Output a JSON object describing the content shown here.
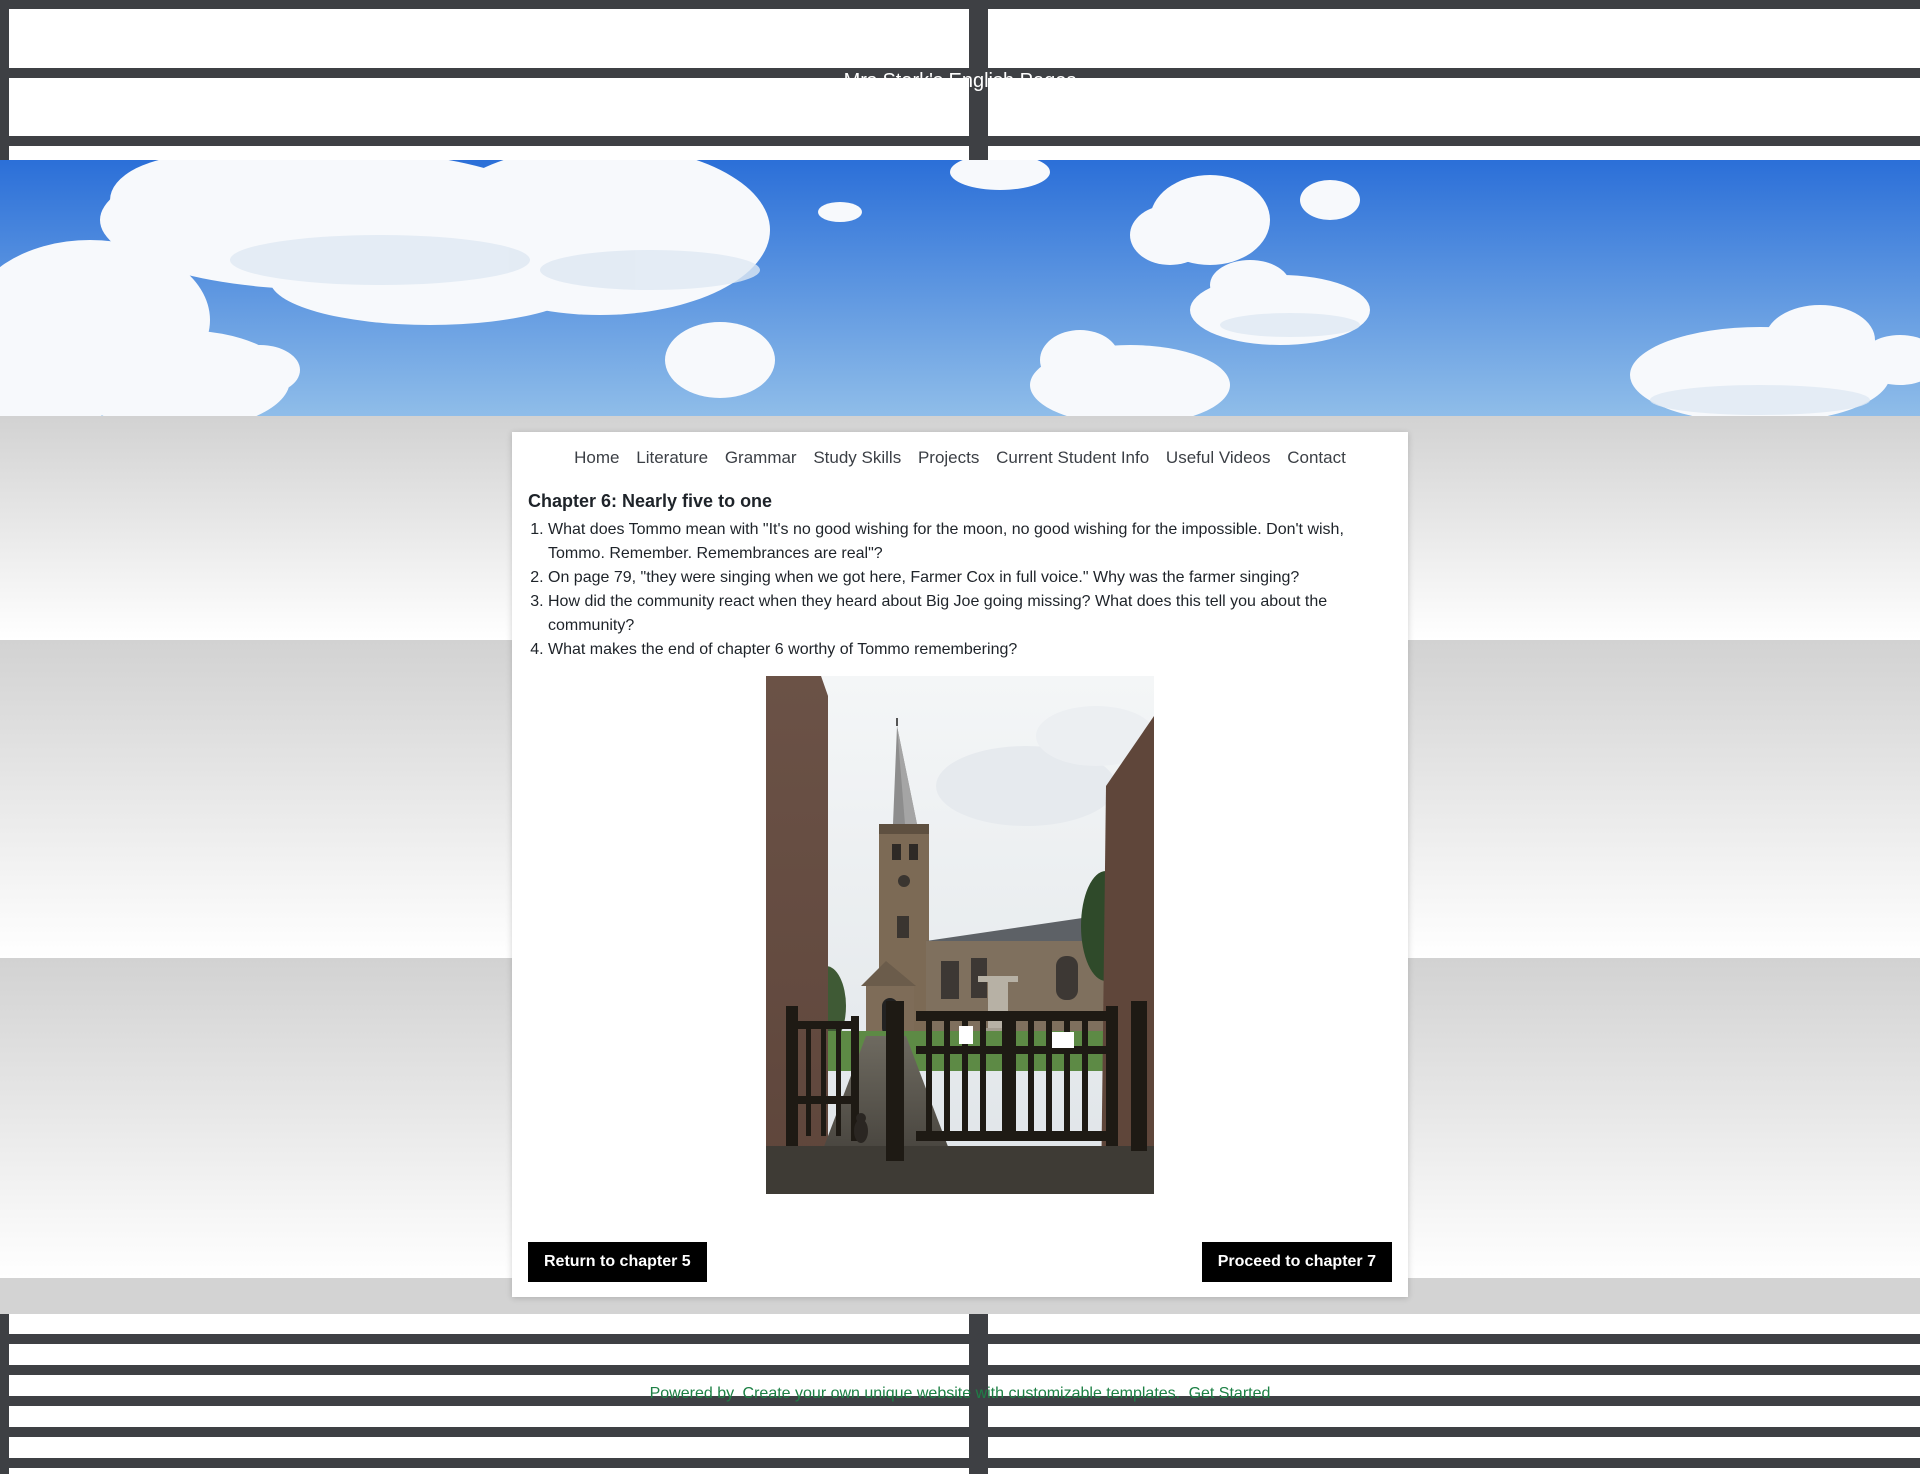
{
  "header": {
    "site_title": "Mrs Stark's English Pages"
  },
  "nav": {
    "items": [
      "Home",
      "Literature",
      "Grammar",
      "Study Skills",
      "Projects",
      "Current Student Info",
      "Useful Videos",
      "Contact"
    ]
  },
  "main": {
    "heading": "Chapter 6: Nearly five to one",
    "questions": [
      "What does Tommo mean with \"It's no good wishing for the moon, no good wishing for the impossible. Don't wish, Tommo. Remember. Remembrances are real\"?",
      "On page 79, \"they were singing when we got here, Farmer Cox in full voice.\" Why was the farmer singing?",
      "How did the community react when they heard about Big Joe going missing? What does this tell you about the community?",
      "What makes the end of chapter 6 worthy of Tommo remembering?"
    ],
    "prev_button": "Return to chapter 5",
    "next_button": "Proceed to chapter 7"
  },
  "footer": {
    "powered_by": "Powered by",
    "cta_text": "Create your own unique website with customizable templates.",
    "get_started": "Get Started"
  },
  "colors": {
    "stripe": "#3e4044",
    "sky_top": "#2b6fd8",
    "sky_bottom": "#8fbde9",
    "footer_link": "#1d8045",
    "button_bg": "#000000"
  }
}
